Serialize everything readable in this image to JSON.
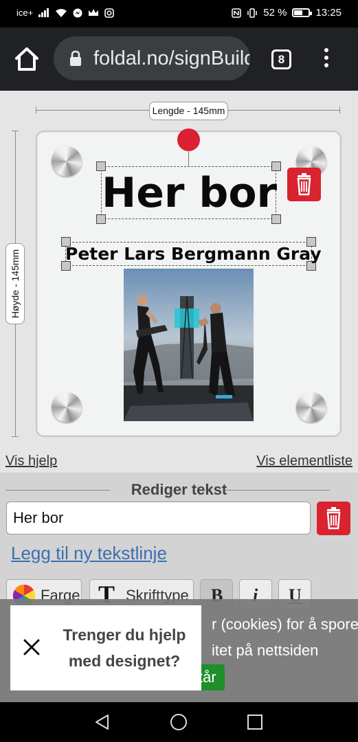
{
  "status_bar": {
    "carrier": "ice+",
    "battery": "52 %",
    "time": "13:25",
    "icons": [
      "signal-icon",
      "wifi-icon",
      "messenger-icon",
      "crown-icon",
      "instagram-icon",
      "nfc-icon",
      "vibrate-icon",
      "battery-icon"
    ]
  },
  "browser": {
    "url": "foldal.no/signBuilder",
    "tab_count": "8"
  },
  "design": {
    "width_label": "Lengde - 145mm",
    "height_label": "Høyde - 145mm",
    "text_line_1": "Her bor",
    "text_line_2": "Peter Lars Bergmann Gray",
    "show_help": "Vis hjelp",
    "show_elements": "Vis elementliste"
  },
  "editor": {
    "section_title": "Rediger tekst",
    "text_value": "Her bor",
    "add_line": "Legg til ny tekstlinje",
    "color_label": "Farge",
    "font_label": "Skrifttype",
    "bold_label": "B",
    "italic_label": "i",
    "underline_label": "U"
  },
  "cookie": {
    "line1": "r (cookies) for å spore",
    "line2": "itet på nettsiden",
    "button": "tår"
  },
  "help_popup": {
    "text": "Trenger du hjelp med designet?"
  },
  "colors": {
    "accent_red": "#d9232f",
    "link_blue": "#3c6fb0",
    "cookie_green": "#1e8f2a"
  }
}
